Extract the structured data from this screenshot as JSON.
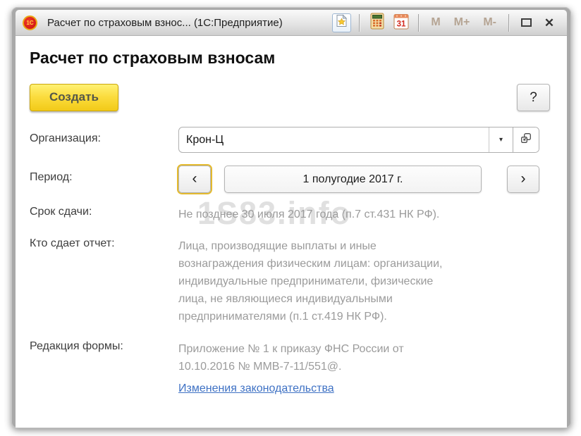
{
  "titlebar": {
    "app_logo_text": "1С",
    "title": "Расчет по страховым взнос... (1С:Предприятие)",
    "memory_buttons": [
      "M",
      "M+",
      "M-"
    ],
    "calendar_day": "31",
    "close_glyph": "✕"
  },
  "page": {
    "title": "Расчет по страховым взносам",
    "create_button_label": "Создать",
    "help_button_label": "?"
  },
  "form": {
    "organization": {
      "label": "Организация:",
      "value": "Крон-Ц",
      "dropdown_glyph": "▾"
    },
    "period": {
      "label": "Период:",
      "value": "1 полугодие 2017 г.",
      "prev_glyph": "‹",
      "next_glyph": "›"
    },
    "deadline": {
      "label": "Срок сдачи:",
      "value": "Не позднее 30 июля 2017 года (п.7 ст.431 НК РФ)."
    },
    "who_submits": {
      "label": "Кто сдает отчет:",
      "value": "Лица, производящие выплаты и иные\nвознаграждения физическим лицам: организации,\nиндивидуальные предприниматели, физические\nлица, не являющиеся индивидуальными\nпредпринимателями (п.1 ст.419 НК РФ)."
    },
    "form_edition": {
      "label": "Редакция формы:",
      "value": "Приложение № 1 к приказу ФНС России от\n10.10.2016 № ММВ-7-11/551@."
    },
    "law_changes_link": "Изменения законодательства"
  },
  "watermark": "1S83.info",
  "colors": {
    "accent_yellow": "#f5d327",
    "link_blue": "#3e71c4",
    "frame_gray": "#a9a9a9",
    "value_gray": "#9b9b9b"
  }
}
